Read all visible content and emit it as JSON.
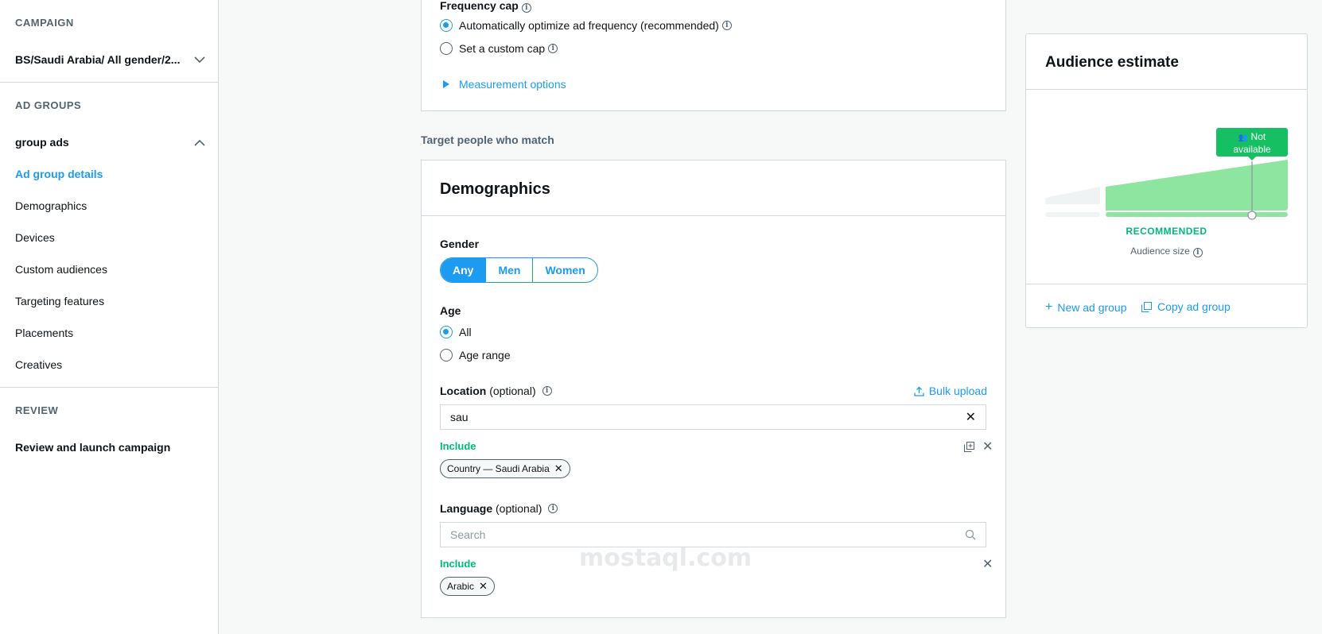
{
  "sidebar": {
    "campaign_header": "CAMPAIGN",
    "campaign_name": "BS/Saudi Arabia/ All gender/2...",
    "adgroups_header": "AD GROUPS",
    "adgroup_name": "group ads",
    "items": [
      {
        "label": "Ad group details",
        "active": true
      },
      {
        "label": "Demographics"
      },
      {
        "label": "Devices"
      },
      {
        "label": "Custom audiences"
      },
      {
        "label": "Targeting features"
      },
      {
        "label": "Placements"
      },
      {
        "label": "Creatives"
      }
    ],
    "review_header": "REVIEW",
    "review_item": "Review and launch campaign"
  },
  "frequency": {
    "title": "Frequency cap",
    "option_auto": "Automatically optimize ad frequency (recommended)",
    "option_custom": "Set a custom cap",
    "measurement_link": "Measurement options"
  },
  "target_heading": "Target people who match",
  "demographics": {
    "title": "Demographics",
    "gender_label": "Gender",
    "gender_options": [
      "Any",
      "Men",
      "Women"
    ],
    "gender_selected": "Any",
    "age_label": "Age",
    "age_all": "All",
    "age_range": "Age range",
    "location_label": "Location",
    "location_optional": "(optional)",
    "bulk_upload": "Bulk upload",
    "location_value": "sau",
    "location_include": "Include",
    "location_chip": "Country — Saudi Arabia",
    "language_label": "Language",
    "language_optional": "(optional)",
    "language_placeholder": "Search",
    "language_include": "Include",
    "language_chip": "Arabic"
  },
  "audience": {
    "title": "Audience estimate",
    "badge_line1": "Not",
    "badge_line2": "available",
    "recommended": "RECOMMENDED",
    "size_label": "Audience size",
    "new_ad_group": "New ad group",
    "copy_ad_group": "Copy ad group"
  },
  "watermark": "mostaql.com",
  "colors": {
    "accent": "#1d9bf0",
    "green": "#00ba7c",
    "badge": "#17bf63",
    "chart_fill": "#8de59f"
  }
}
